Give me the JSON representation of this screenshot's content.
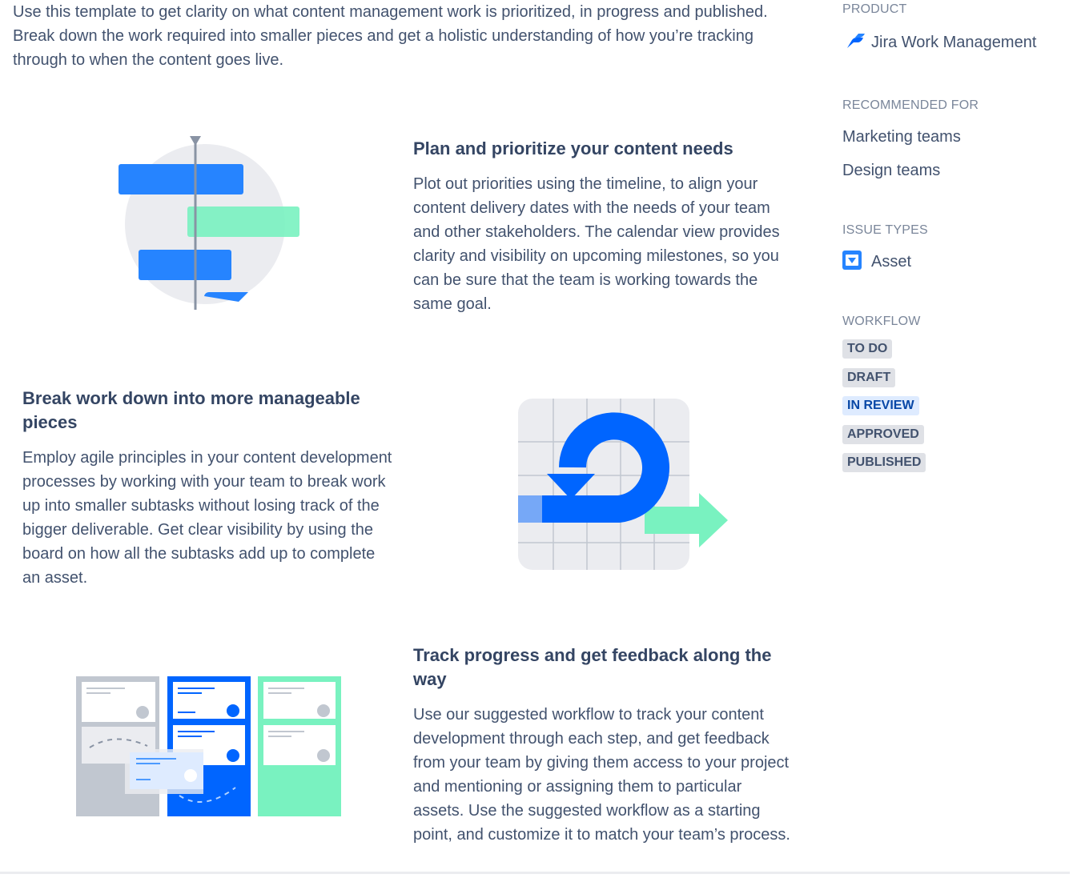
{
  "intro": "Use this template to get clarity on what content management work is prioritized, in progress and published. Break down the work required into smaller pieces and get a holistic understanding of how you’re tracking through to when the content goes live.",
  "features": [
    {
      "title": "Plan and prioritize your content needs",
      "body": "Plot out priorities using the timeline, to align your content delivery dates with the needs of your team and other stakeholders. The calendar view provides clarity and visibility on upcoming milestones, so you can be sure that the team is working towards the same goal."
    },
    {
      "title": "Break work down into more manageable pieces",
      "body": "Employ agile principles in your content development processes by working with your team to break work up into smaller subtasks without losing track of the bigger deliverable. Get clear visibility by using the board on how all the subtasks add up to complete an asset."
    },
    {
      "title": "Track progress and get feedback along the way",
      "body": "Use our suggested workflow to track your content development through each step, and get feedback from your team by giving them access to your project and mentioning or assigning them to particular assets. Use the suggested workflow as a starting point, and customize it to match your team’s process."
    }
  ],
  "sidebar": {
    "product_label": "PRODUCT",
    "product_name": "Jira Work Management",
    "product_icon": "jira-work-management-logo",
    "recommended_label": "RECOMMENDED FOR",
    "recommended": [
      "Marketing teams",
      "Design teams"
    ],
    "issue_types_label": "ISSUE TYPES",
    "issue_types": [
      {
        "name": "Asset",
        "icon": "asset-issue-icon"
      }
    ],
    "workflow_label": "WORKFLOW",
    "workflow": [
      "TO DO",
      "DRAFT",
      "IN REVIEW",
      "APPROVED",
      "PUBLISHED"
    ]
  },
  "colors": {
    "brand_blue": "#0065ff",
    "accent_green": "#79f2c0",
    "text": "#42526e",
    "heading": "#344563",
    "muted": "#7a869a",
    "lozenge_gray": "#dfe1e6",
    "lozenge_blue": "#deebff"
  }
}
